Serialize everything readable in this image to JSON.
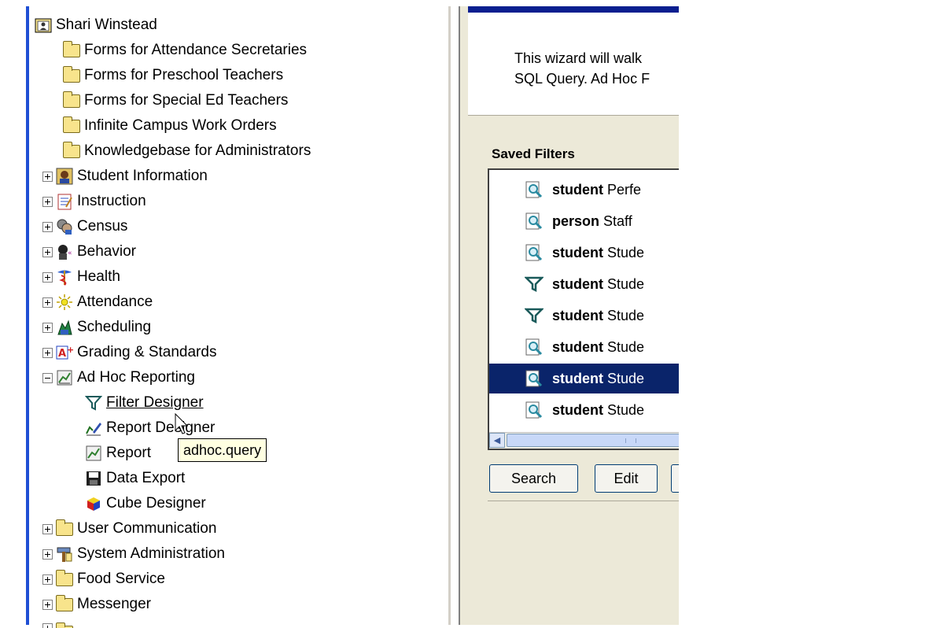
{
  "tree": {
    "items": [
      {
        "label": "Shari Winstead",
        "icon": "user-folder-icon",
        "expander": null
      },
      {
        "label": "Forms for Attendance Secretaries",
        "icon": "folder-icon",
        "expander": null
      },
      {
        "label": "Forms for Preschool Teachers",
        "icon": "folder-icon",
        "expander": null
      },
      {
        "label": "Forms for Special Ed Teachers",
        "icon": "folder-icon",
        "expander": null
      },
      {
        "label": "Infinite Campus Work Orders",
        "icon": "folder-icon",
        "expander": null
      },
      {
        "label": "Knowledgebase for Administrators",
        "icon": "folder-icon",
        "expander": null
      },
      {
        "label": "Student Information",
        "icon": "student-icon",
        "expander": "plus"
      },
      {
        "label": "Instruction",
        "icon": "notebook-icon",
        "expander": "plus"
      },
      {
        "label": "Census",
        "icon": "census-icon",
        "expander": "plus"
      },
      {
        "label": "Behavior",
        "icon": "behavior-icon",
        "expander": "plus"
      },
      {
        "label": "Health",
        "icon": "caduceus-icon",
        "expander": "plus"
      },
      {
        "label": "Attendance",
        "icon": "attendance-icon",
        "expander": "plus"
      },
      {
        "label": "Scheduling",
        "icon": "scheduling-icon",
        "expander": "plus"
      },
      {
        "label": "Grading & Standards",
        "icon": "grade-icon",
        "expander": "plus"
      },
      {
        "label": "Ad Hoc Reporting",
        "icon": "report-icon",
        "expander": "minus"
      },
      {
        "label": "Filter Designer",
        "icon": "filter-icon",
        "expander": null
      },
      {
        "label": "Report Designer",
        "icon": "report-designer-icon",
        "expander": null
      },
      {
        "label": "Report",
        "icon": "report-icon",
        "expander": null
      },
      {
        "label": "Data Export",
        "icon": "floppy-icon",
        "expander": null
      },
      {
        "label": "Cube Designer",
        "icon": "cube-icon",
        "expander": null
      },
      {
        "label": "User Communication",
        "icon": "folder-icon",
        "expander": "plus"
      },
      {
        "label": "System Administration",
        "icon": "tools-icon",
        "expander": "plus"
      },
      {
        "label": "Food Service",
        "icon": "folder-icon",
        "expander": "plus"
      },
      {
        "label": "Messenger",
        "icon": "folder-icon",
        "expander": "plus"
      }
    ]
  },
  "tooltip": "adhoc.query",
  "wizard": {
    "line1": "This wizard will walk",
    "line2": "SQL Query. Ad Hoc F"
  },
  "saved_filters": {
    "heading": "Saved Filters",
    "items": [
      {
        "type": "student",
        "name": "Perfe",
        "icon": "query-icon",
        "selected": false
      },
      {
        "type": "person",
        "name": "Staff",
        "icon": "query-icon",
        "selected": false
      },
      {
        "type": "student",
        "name": "Stude",
        "icon": "query-icon",
        "selected": false
      },
      {
        "type": "student",
        "name": "Stude",
        "icon": "filter-icon",
        "selected": false
      },
      {
        "type": "student",
        "name": "Stude",
        "icon": "filter-icon",
        "selected": false
      },
      {
        "type": "student",
        "name": "Stude",
        "icon": "query-icon",
        "selected": false
      },
      {
        "type": "student",
        "name": "Stude",
        "icon": "query-icon",
        "selected": true
      },
      {
        "type": "student",
        "name": "Stude",
        "icon": "query-icon",
        "selected": false
      }
    ]
  },
  "buttons": {
    "search": "Search",
    "edit": "Edit"
  },
  "colors": {
    "accent_bar": "#1f4fd4",
    "selection": "#0a246a",
    "panel_bg": "#ece9d8"
  }
}
